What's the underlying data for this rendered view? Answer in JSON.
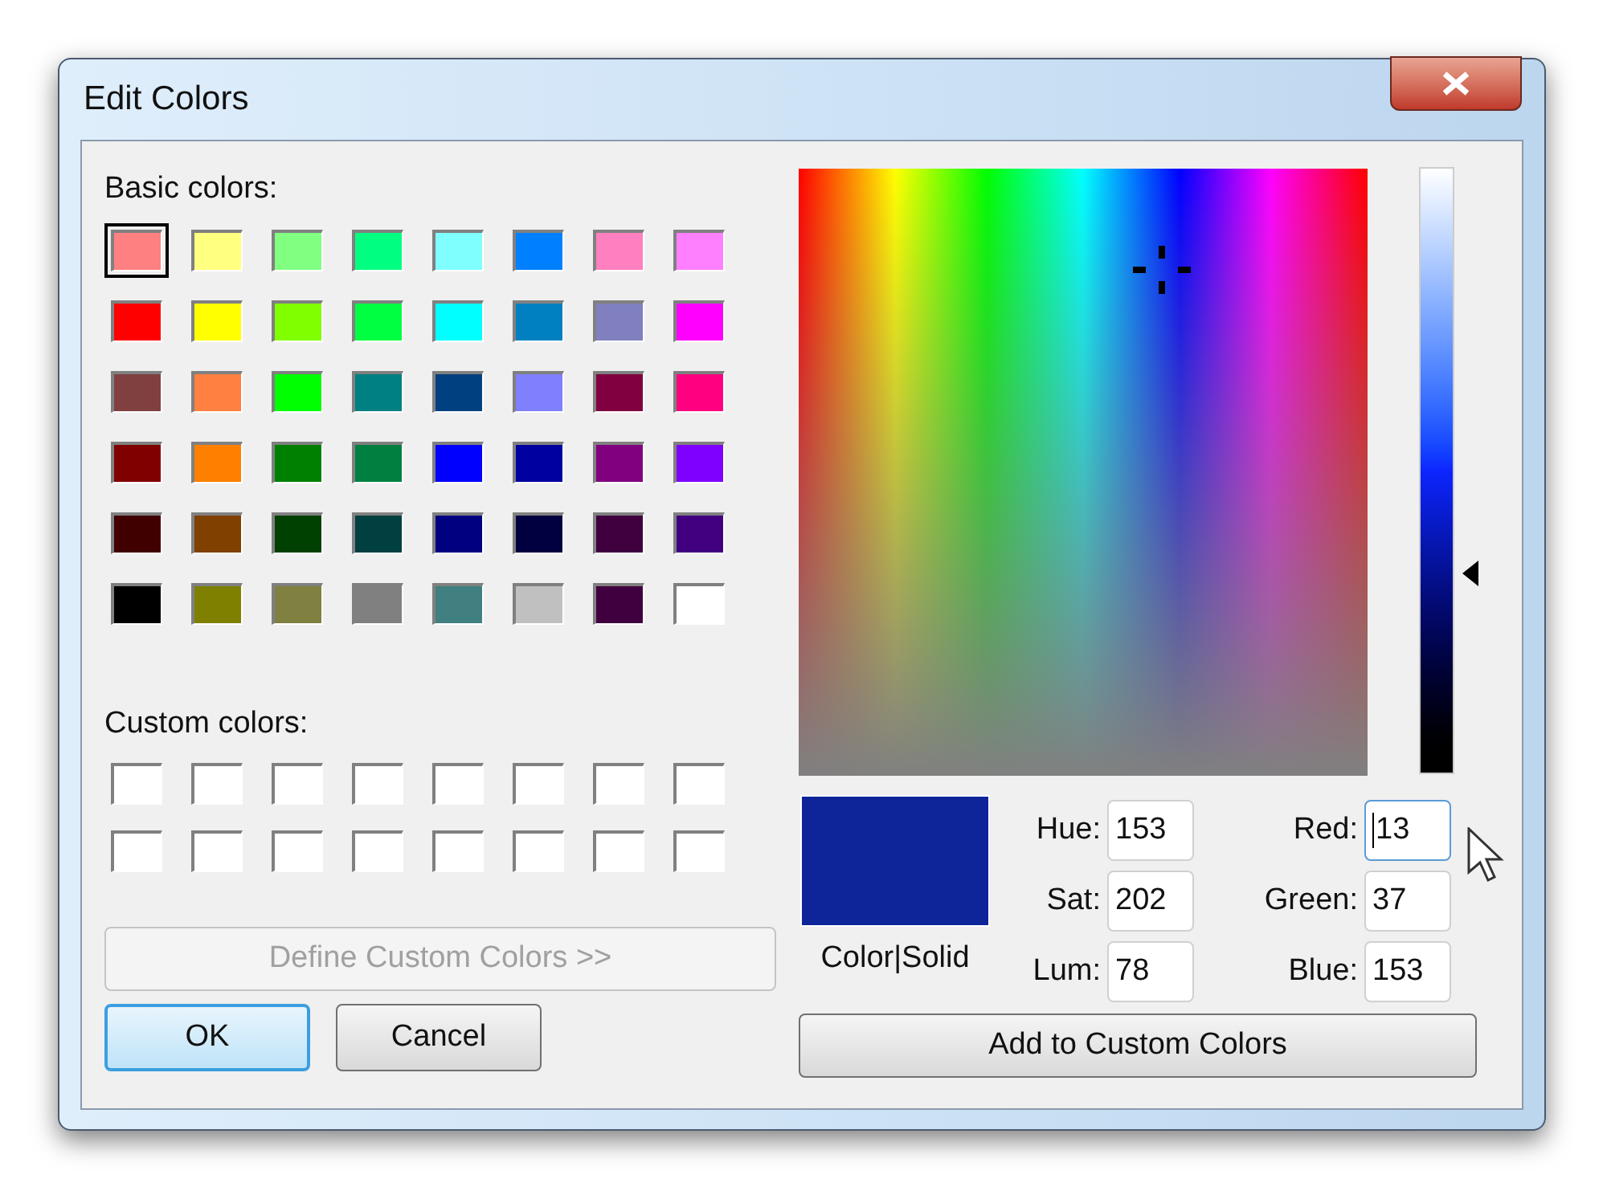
{
  "window": {
    "title": "Edit Colors"
  },
  "basic_colors": {
    "label": "Basic colors:",
    "swatches": [
      {
        "color": "#ff8080",
        "selected": true
      },
      {
        "color": "#ffff80",
        "selected": false
      },
      {
        "color": "#80ff80",
        "selected": false
      },
      {
        "color": "#00ff80",
        "selected": false
      },
      {
        "color": "#80ffff",
        "selected": false
      },
      {
        "color": "#0080ff",
        "selected": false
      },
      {
        "color": "#ff80c0",
        "selected": false
      },
      {
        "color": "#ff80ff",
        "selected": false
      },
      {
        "color": "#ff0000",
        "selected": false
      },
      {
        "color": "#ffff00",
        "selected": false
      },
      {
        "color": "#80ff00",
        "selected": false
      },
      {
        "color": "#00ff40",
        "selected": false
      },
      {
        "color": "#00ffff",
        "selected": false
      },
      {
        "color": "#0080c0",
        "selected": false
      },
      {
        "color": "#8080c0",
        "selected": false
      },
      {
        "color": "#ff00ff",
        "selected": false
      },
      {
        "color": "#804040",
        "selected": false
      },
      {
        "color": "#ff8040",
        "selected": false
      },
      {
        "color": "#00ff00",
        "selected": false
      },
      {
        "color": "#008080",
        "selected": false
      },
      {
        "color": "#004080",
        "selected": false
      },
      {
        "color": "#8080ff",
        "selected": false
      },
      {
        "color": "#800040",
        "selected": false
      },
      {
        "color": "#ff0080",
        "selected": false
      },
      {
        "color": "#800000",
        "selected": false
      },
      {
        "color": "#ff8000",
        "selected": false
      },
      {
        "color": "#008000",
        "selected": false
      },
      {
        "color": "#008040",
        "selected": false
      },
      {
        "color": "#0000ff",
        "selected": false
      },
      {
        "color": "#0000a0",
        "selected": false
      },
      {
        "color": "#800080",
        "selected": false
      },
      {
        "color": "#8000ff",
        "selected": false
      },
      {
        "color": "#400000",
        "selected": false
      },
      {
        "color": "#804000",
        "selected": false
      },
      {
        "color": "#004000",
        "selected": false
      },
      {
        "color": "#004040",
        "selected": false
      },
      {
        "color": "#000080",
        "selected": false
      },
      {
        "color": "#000040",
        "selected": false
      },
      {
        "color": "#400040",
        "selected": false
      },
      {
        "color": "#400080",
        "selected": false
      },
      {
        "color": "#000000",
        "selected": false
      },
      {
        "color": "#808000",
        "selected": false
      },
      {
        "color": "#808040",
        "selected": false
      },
      {
        "color": "#808080",
        "selected": false
      },
      {
        "color": "#408080",
        "selected": false
      },
      {
        "color": "#c0c0c0",
        "selected": false
      },
      {
        "color": "#400040",
        "selected": false
      },
      {
        "color": "#ffffff",
        "selected": false
      }
    ]
  },
  "custom_colors": {
    "label": "Custom colors:",
    "swatches": [
      {
        "color": "#ffffff"
      },
      {
        "color": "#ffffff"
      },
      {
        "color": "#ffffff"
      },
      {
        "color": "#ffffff"
      },
      {
        "color": "#ffffff"
      },
      {
        "color": "#ffffff"
      },
      {
        "color": "#ffffff"
      },
      {
        "color": "#ffffff"
      },
      {
        "color": "#ffffff"
      },
      {
        "color": "#ffffff"
      },
      {
        "color": "#ffffff"
      },
      {
        "color": "#ffffff"
      },
      {
        "color": "#ffffff"
      },
      {
        "color": "#ffffff"
      },
      {
        "color": "#ffffff"
      },
      {
        "color": "#ffffff"
      }
    ]
  },
  "define_button": {
    "label": "Define Custom Colors >>",
    "disabled": true
  },
  "ok_button": {
    "label": "OK",
    "default": true
  },
  "cancel_button": {
    "label": "Cancel"
  },
  "luminance_slider": {
    "level": 0.33
  },
  "preview": {
    "color": "#0d2599",
    "label": "Color|Solid"
  },
  "hsl_fields": [
    {
      "label": "Hue:",
      "value": "153",
      "focused": false
    },
    {
      "label": "Sat:",
      "value": "202",
      "focused": false
    },
    {
      "label": "Lum:",
      "value": "78",
      "focused": false
    }
  ],
  "rgb_fields": [
    {
      "label": "Red:",
      "value": "13",
      "focused": true
    },
    {
      "label": "Green:",
      "value": "37",
      "focused": false
    },
    {
      "label": "Blue:",
      "value": "153",
      "focused": false
    }
  ],
  "add_button": {
    "label": "Add to Custom Colors"
  }
}
